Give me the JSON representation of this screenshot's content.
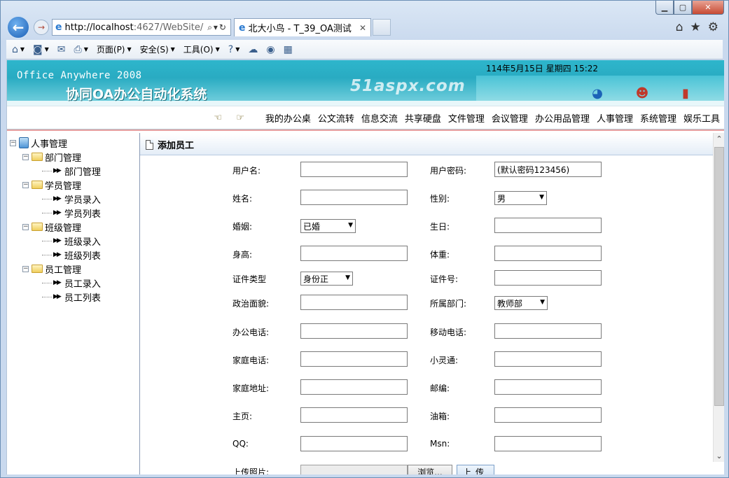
{
  "browser": {
    "address_host": "http://localhost",
    "address_rest": ":4627/WebSite/",
    "tab_title": "北大小鸟 - T_39_OA测试",
    "menu": {
      "page": "页面(P)",
      "safety": "安全(S)",
      "tools": "工具(O)"
    }
  },
  "header": {
    "app_name_en": "Office Anywhere 2008",
    "app_name_cn": "协同OA办公自动化系统",
    "watermark": "51aspx.com",
    "datetime": "114年5月15日 星期四 15:22"
  },
  "nav": {
    "items": [
      "我的办公桌",
      "公文流转",
      "信息交流",
      "共享硬盘",
      "文件管理",
      "会议管理",
      "办公用品管理",
      "人事管理",
      "系统管理",
      "娱乐工具"
    ]
  },
  "tree": {
    "root": "人事管理",
    "groups": [
      {
        "label": "部门管理",
        "children": [
          "部门管理"
        ]
      },
      {
        "label": "学员管理",
        "children": [
          "学员录入",
          "学员列表"
        ]
      },
      {
        "label": "班级管理",
        "children": [
          "班级录入",
          "班级列表"
        ]
      },
      {
        "label": "员工管理",
        "children": [
          "员工录入",
          "员工列表"
        ]
      }
    ]
  },
  "form": {
    "title": "添加员工",
    "username_label": "用户名:",
    "password_label": "用户密码:",
    "password_value": "(默认密码123456)",
    "name_label": "姓名:",
    "sex_label": "性别:",
    "sex_value": "男",
    "marriage_label": "婚姻:",
    "marriage_value": "已婚",
    "birthday_label": "生日:",
    "height_label": "身高:",
    "weight_label": "体重:",
    "idtype_label": "证件类型",
    "idtype_value": "身份正",
    "idno_label": "证件号:",
    "politics_label": "政治面貌:",
    "dept_label": "所属部门:",
    "dept_value": "教师部",
    "office_phone_label": "办公电话:",
    "mobile_label": "移动电话:",
    "home_phone_label": "家庭电话:",
    "phs_label": "小灵通:",
    "address_label": "家庭地址:",
    "zip_label": "邮编:",
    "homepage_label": "主页:",
    "email_label": "油箱:",
    "qq_label": "QQ:",
    "msn_label": "Msn:",
    "photo_label": "上传照片:",
    "browse_label": "浏览...",
    "upload_label": "上传"
  }
}
